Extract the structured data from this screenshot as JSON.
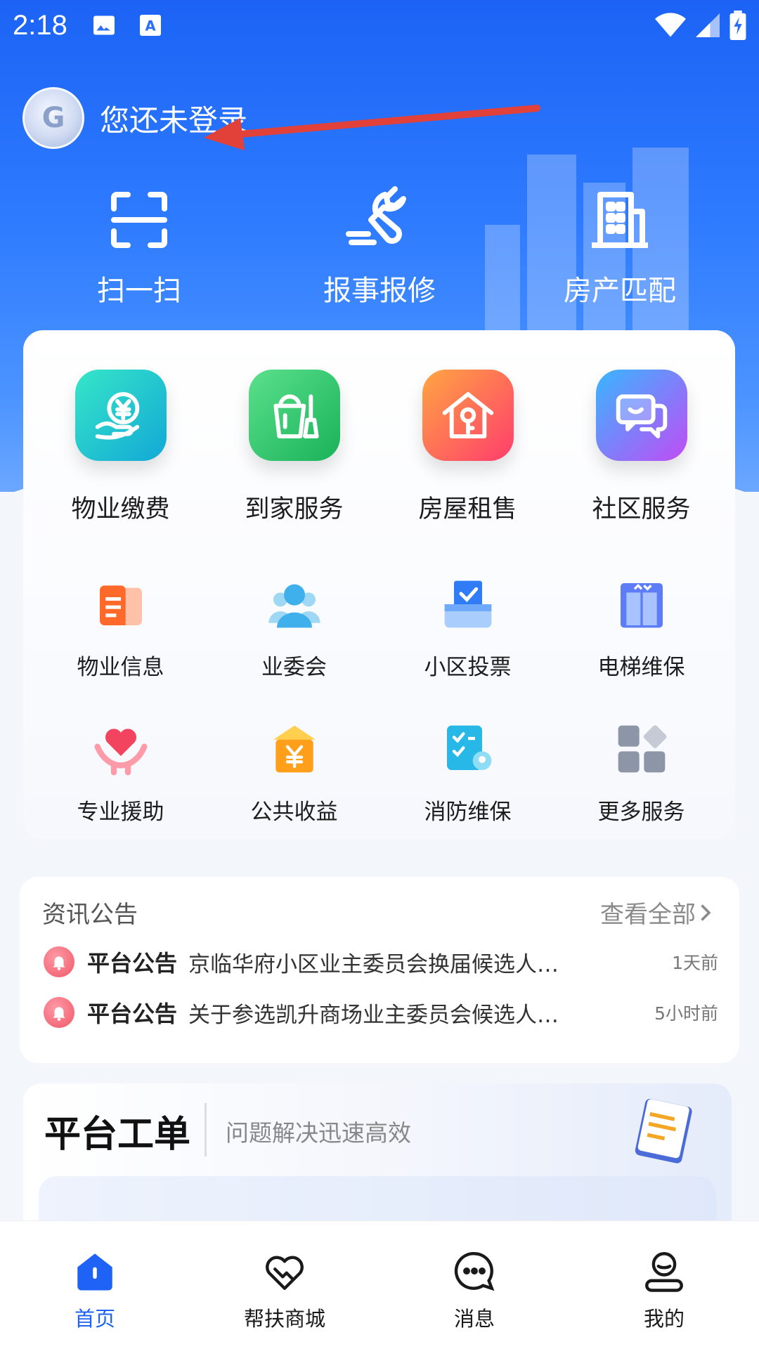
{
  "status_bar": {
    "time": "2:18"
  },
  "user": {
    "login_prompt": "您还未登录"
  },
  "top_actions": [
    {
      "label": "扫一扫",
      "icon": "scan-icon"
    },
    {
      "label": "报事报修",
      "icon": "wrench-icon"
    },
    {
      "label": "房产匹配",
      "icon": "building-icon"
    }
  ],
  "services": {
    "row1": [
      {
        "label": "物业缴费",
        "icon": "yen-hand-icon",
        "color": "#19c6c0"
      },
      {
        "label": "到家服务",
        "icon": "bucket-broom-icon",
        "color": "#2fc96e"
      },
      {
        "label": "房屋租售",
        "icon": "house-key-icon",
        "color": "#ff6a3d"
      },
      {
        "label": "社区服务",
        "icon": "chat-bubbles-icon",
        "color": "#7a5cff"
      }
    ],
    "row2": [
      {
        "label": "物业信息",
        "icon": "document-icon"
      },
      {
        "label": "业委会",
        "icon": "group-icon"
      },
      {
        "label": "小区投票",
        "icon": "ballot-box-icon"
      },
      {
        "label": "电梯维保",
        "icon": "elevator-icon"
      }
    ],
    "row3": [
      {
        "label": "专业援助",
        "icon": "heart-hand-icon"
      },
      {
        "label": "公共收益",
        "icon": "yen-house-icon"
      },
      {
        "label": "消防维保",
        "icon": "checklist-pin-icon"
      },
      {
        "label": "更多服务",
        "icon": "grid-more-icon"
      }
    ]
  },
  "news": {
    "heading": "资讯公告",
    "view_all": "查看全部",
    "items": [
      {
        "tag": "平台公告",
        "title": "京临华府小区业主委员会换届候选人…",
        "time": "1天前"
      },
      {
        "tag": "平台公告",
        "title": "关于参选凯升商场业主委员会候选人…",
        "time": "5小时前"
      }
    ]
  },
  "work_order": {
    "title": "平台工单",
    "subtitle": "问题解决迅速高效"
  },
  "bottom_nav": [
    {
      "label": "首页",
      "icon": "home-icon",
      "active": true
    },
    {
      "label": "帮扶商城",
      "icon": "handshake-heart-icon"
    },
    {
      "label": "消息",
      "icon": "message-icon"
    },
    {
      "label": "我的",
      "icon": "profile-icon"
    }
  ],
  "colors": {
    "primary": "#1e63f5",
    "annotation_arrow": "#e2413a"
  }
}
